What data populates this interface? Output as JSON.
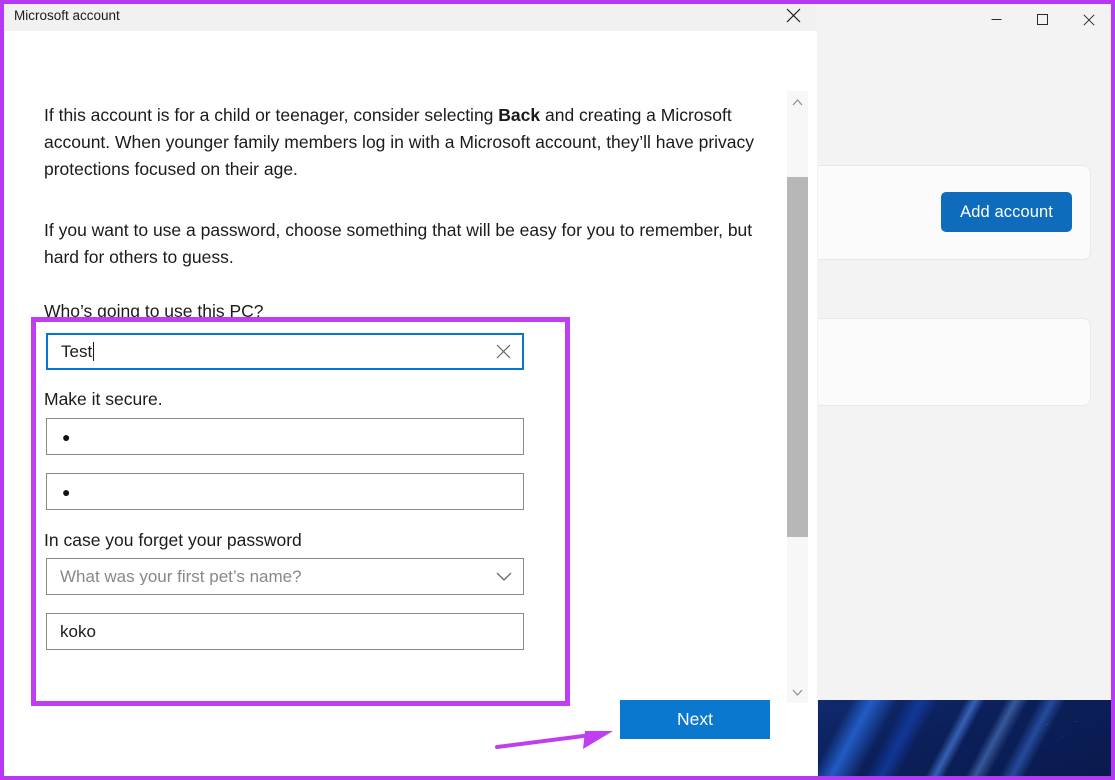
{
  "annotations": {
    "highlight_color": "#c13ef0",
    "arrow_color": "#c13ef0",
    "frame_color": "#b739f5"
  },
  "background_window": {
    "name": "settings-window",
    "titlebar": {
      "minimize_label": "Minimize",
      "maximize_label": "Maximize",
      "close_label": "Close"
    },
    "add_account_button": "Add account"
  },
  "dialog": {
    "title": "Microsoft account",
    "close_label": "Close",
    "paragraphs": {
      "p1_before": "If this account is for a child or teenager, consider selecting ",
      "p1_bold": "Back",
      "p1_after": " and creating a Microsoft account. When younger family members log in with a Microsoft account, they’ll have privacy protections focused on their age.",
      "p2": "If you want to use a password, choose something that will be easy for you to remember, but hard for others to guess."
    },
    "labels": {
      "who": "Who’s going to use this PC?",
      "secure": "Make it secure.",
      "forget": "In case you forget your password"
    },
    "fields": {
      "username": {
        "value": "Test",
        "clear_icon": "close-icon",
        "focused": true
      },
      "password": {
        "value": "●"
      },
      "confirm_password": {
        "value": "●"
      },
      "security_question": {
        "value": "What was your first pet’s name?",
        "is_placeholder": true,
        "chevron_icon": "chevron-down-icon"
      },
      "security_answer": {
        "value": "koko"
      }
    },
    "next_button": "Next",
    "scrollbar": {
      "up_icon": "chevron-up-icon",
      "down_icon": "chevron-down-icon"
    }
  }
}
